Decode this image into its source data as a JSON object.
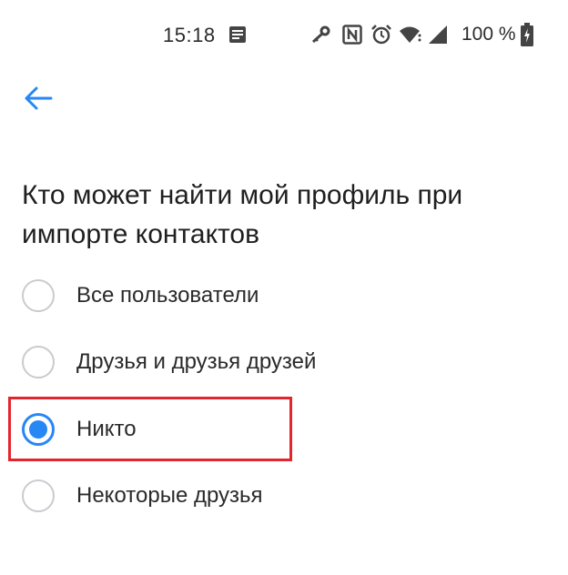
{
  "status_bar": {
    "time": "15:18",
    "battery": "100 %",
    "icons": [
      "message-icon",
      "key-icon",
      "nfc-icon",
      "alarm-icon",
      "wifi-icon",
      "signal-icon",
      "battery-icon"
    ]
  },
  "header": {
    "back_icon": "arrow-left-icon"
  },
  "title": "Кто может найти мой профиль при импорте контактов",
  "options": [
    {
      "label": "Все пользователи",
      "selected": false
    },
    {
      "label": "Друзья и друзья друзей",
      "selected": false
    },
    {
      "label": "Никто",
      "selected": true
    },
    {
      "label": "Некоторые друзья",
      "selected": false
    }
  ],
  "colors": {
    "accent": "#2787f5",
    "highlight": "#e3262e",
    "radio_border": "#c9cbcf",
    "text": "#2a2a2a"
  }
}
